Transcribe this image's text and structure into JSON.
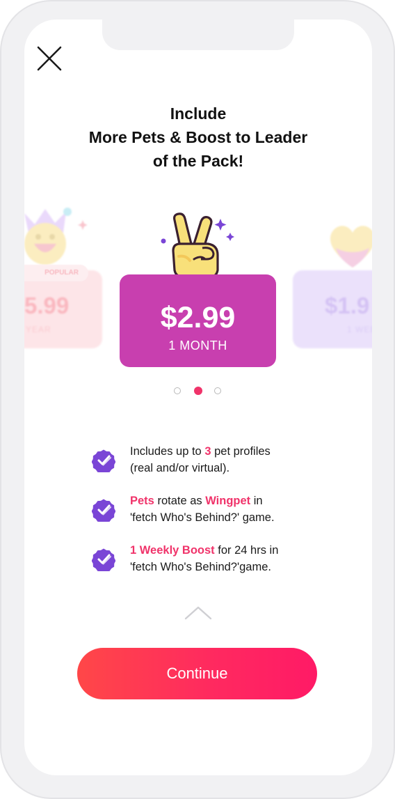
{
  "headline": {
    "line1": "Include",
    "line2": "More Pets & Boost to Leader",
    "line3": "of the Pack!"
  },
  "plans": {
    "left": {
      "badge": "POPULAR",
      "price": "5.99",
      "period": "YEAR"
    },
    "center": {
      "price": "$2.99",
      "period": "1 MONTH"
    },
    "right": {
      "price": "$1.9",
      "period": "1 WEE"
    }
  },
  "carousel": {
    "page_count": 3,
    "active_index": 1
  },
  "features": [
    {
      "before": "Includes up to ",
      "highlight": "3",
      "after": " pet profiles",
      "line2": "(real and/or virtual)."
    },
    {
      "highlight": "Pets",
      "mid": " rotate as ",
      "highlight2": "Wingpet",
      "after": " in",
      "line2": "'fetch Who's Behind?' game."
    },
    {
      "highlight": "1 Weekly Boost",
      "after": " for 24 hrs in",
      "line2": "'fetch Who's Behind?'game."
    }
  ],
  "continue_label": "Continue",
  "colors": {
    "accent": "#f0336a",
    "card_magenta": "#c83faf",
    "check_purple": "#7a45d6",
    "button_start": "#ff4748",
    "button_end": "#ff1a66",
    "dot_active": "#f0336a",
    "dot_inactive": "#b8b8b8"
  },
  "icons": [
    "close-icon",
    "crown-emoji-icon",
    "victory-hand-icon",
    "heart-icon",
    "check-badge-icon",
    "chevron-up-icon"
  ]
}
